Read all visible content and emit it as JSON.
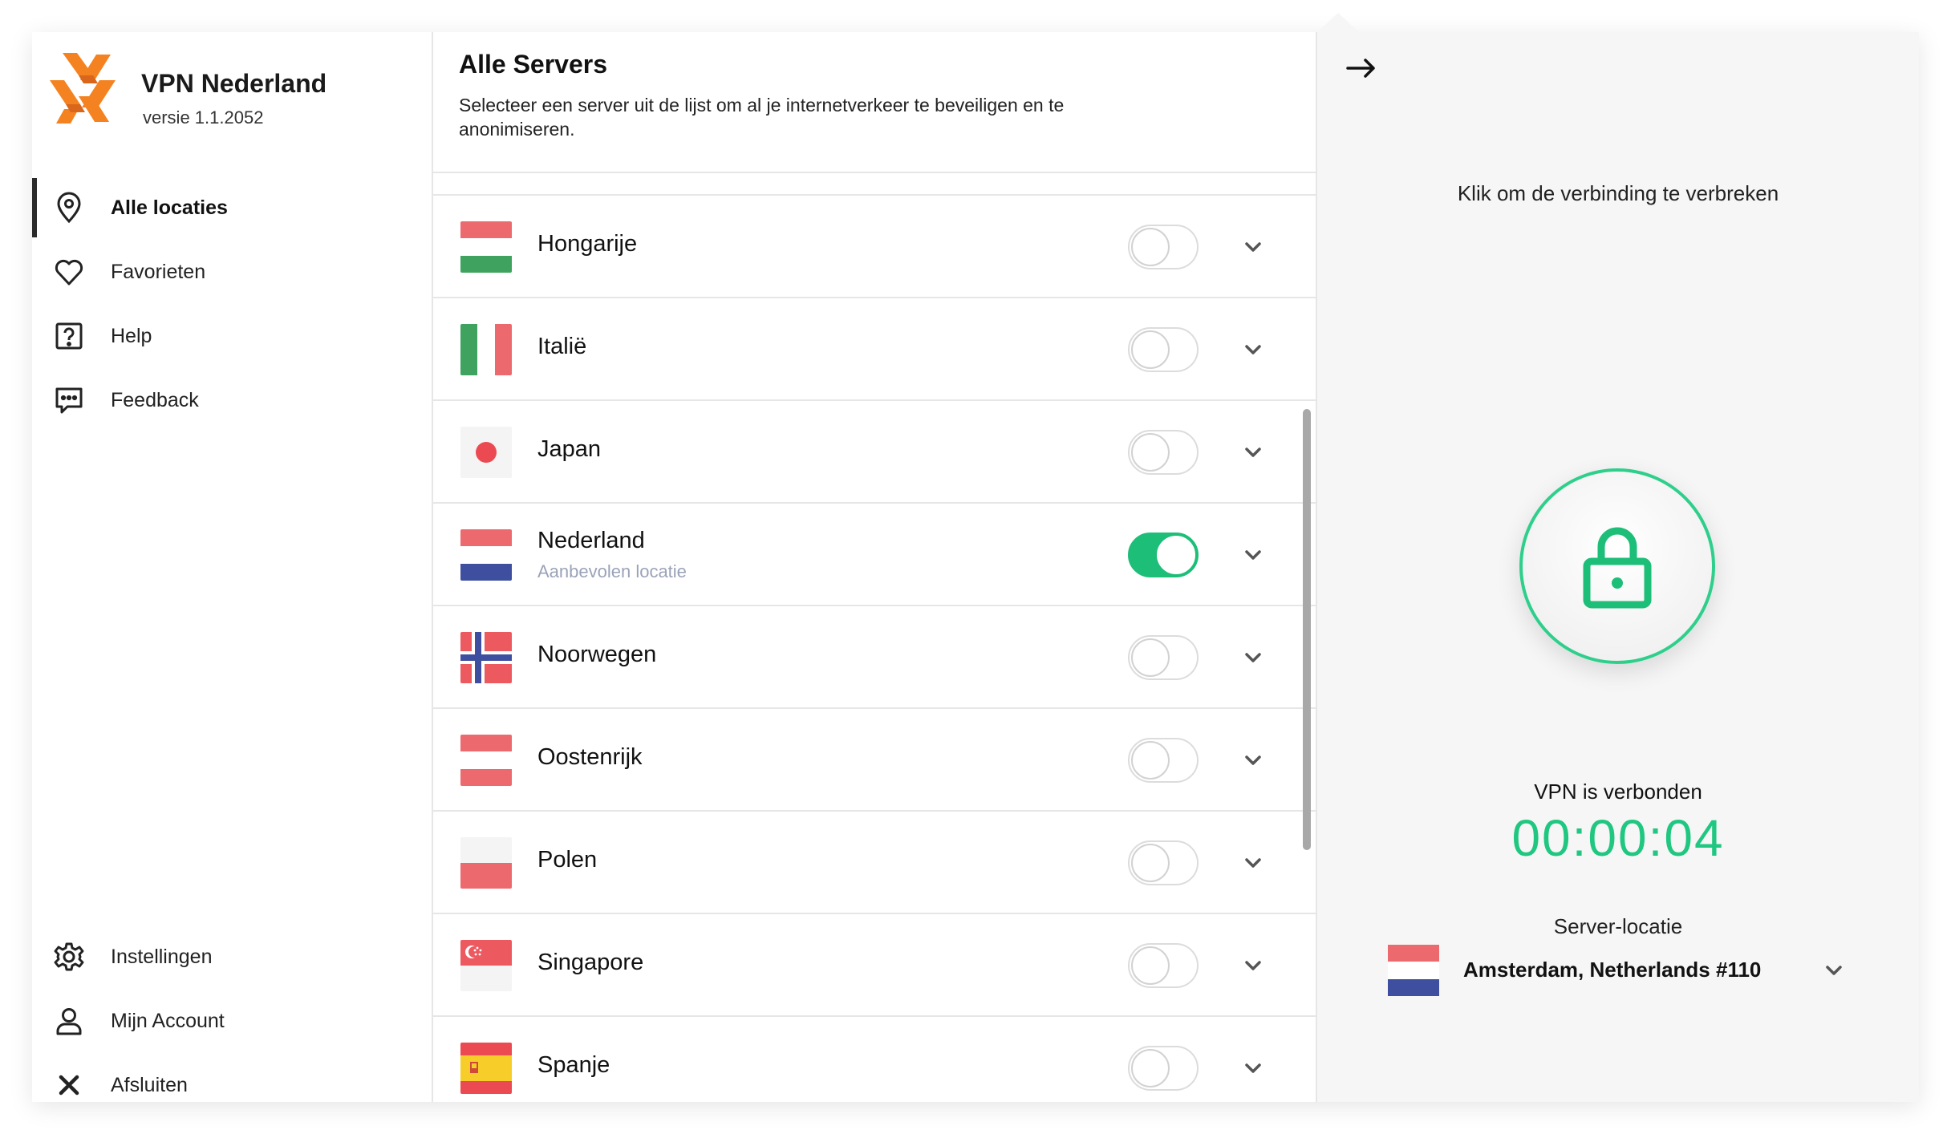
{
  "app": {
    "title": "VPN Nederland",
    "version": "versie 1.1.2052",
    "accent_color": "#1dbe78",
    "logo_color": "#f58220"
  },
  "sidebar": {
    "items": [
      {
        "label": "Alle locaties",
        "icon": "location-pin-icon",
        "active": true
      },
      {
        "label": "Favorieten",
        "icon": "heart-icon"
      },
      {
        "label": "Help",
        "icon": "question-icon"
      },
      {
        "label": "Feedback",
        "icon": "chat-icon"
      }
    ],
    "bottom_items": [
      {
        "label": "Instellingen",
        "icon": "gear-icon"
      },
      {
        "label": "Mijn Account",
        "icon": "user-icon"
      },
      {
        "label": "Afsluiten",
        "icon": "close-icon"
      }
    ]
  },
  "main": {
    "title": "Alle Servers",
    "description": "Selecteer een server uit de lijst om al je internetverkeer te beveiligen en te anonimiseren.",
    "servers": [
      {
        "name": "Hongarije",
        "flag": "hungary-flag",
        "enabled": false
      },
      {
        "name": "Italië",
        "flag": "italy-flag",
        "enabled": false
      },
      {
        "name": "Japan",
        "flag": "japan-flag",
        "enabled": false
      },
      {
        "name": "Nederland",
        "subtitle": "Aanbevolen locatie",
        "flag": "netherlands-flag",
        "enabled": true
      },
      {
        "name": "Noorwegen",
        "flag": "norway-flag",
        "enabled": false
      },
      {
        "name": "Oostenrijk",
        "flag": "austria-flag",
        "enabled": false
      },
      {
        "name": "Polen",
        "flag": "poland-flag",
        "enabled": false
      },
      {
        "name": "Singapore",
        "flag": "singapore-flag",
        "enabled": false
      },
      {
        "name": "Spanje",
        "flag": "spain-flag",
        "enabled": false
      }
    ]
  },
  "panel": {
    "hint": "Klik om de verbinding te verbreken",
    "status": "VPN is verbonden",
    "timer": "00:00:04",
    "location_label": "Server-locatie",
    "location_value": "Amsterdam, Netherlands #110",
    "location_flag": "netherlands-flag"
  }
}
